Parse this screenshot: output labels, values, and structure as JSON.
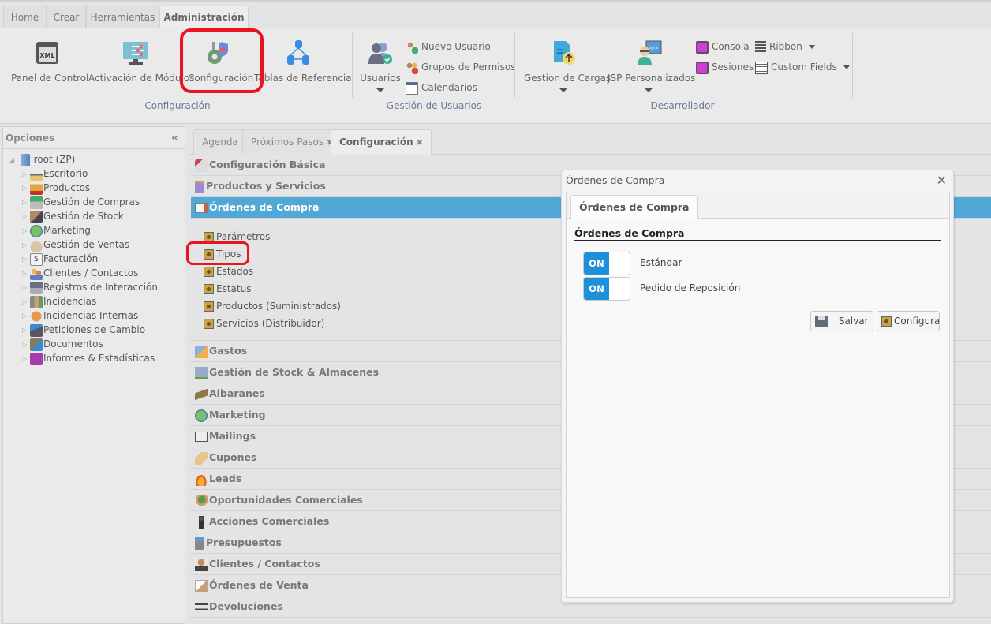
{
  "ribbon": {
    "tabs": [
      {
        "label": "Home",
        "active": false
      },
      {
        "label": "Crear",
        "active": false
      },
      {
        "label": "Herramientas",
        "active": false
      },
      {
        "label": "Administración",
        "active": true
      }
    ],
    "groups": {
      "configuracion": {
        "label": "Configuración",
        "buttons": [
          {
            "label": "Panel de Control",
            "icon": "xml-window-icon"
          },
          {
            "label": "Activación de Módulos",
            "icon": "monitor-sliders-icon"
          },
          {
            "label": "Configuración",
            "icon": "gear-wrench-shield-icon",
            "highlighted": true
          },
          {
            "label": "Tablas de Referencia",
            "icon": "database-tree-icon"
          }
        ]
      },
      "usuarios": {
        "label": "Gestión de Usuarios",
        "main_button": {
          "label": "Usuarios",
          "icon": "users-check-icon",
          "has_dropdown": true
        },
        "small_buttons": [
          {
            "label": "Nuevo Usuario",
            "icon": "user-add-icon"
          },
          {
            "label": "Grupos de Permisos",
            "icon": "user-group-icon"
          },
          {
            "label": "Calendarios",
            "icon": "calendar-icon"
          }
        ]
      },
      "desarrollador": {
        "label": "Desarrollador",
        "buttons": [
          {
            "label": "Gestion de Cargas",
            "icon": "file-upload-icon",
            "has_dropdown": true
          },
          {
            "label": "JSP Personalizados",
            "icon": "developer-code-icon",
            "has_dropdown": true
          }
        ],
        "small_buttons": [
          {
            "label": "Consola",
            "icon": "computer-icon"
          },
          {
            "label": "Sesiones",
            "icon": "computer-icon"
          },
          {
            "label": "Ribbon",
            "icon": "ribbon-list-icon",
            "has_dropdown": true
          },
          {
            "label": "Custom Fields",
            "icon": "form-fields-icon",
            "has_dropdown": true
          }
        ]
      }
    }
  },
  "sidebar": {
    "title": "Opciones",
    "collapse_icon": "«",
    "root": {
      "label": "root (ZP)",
      "icon": "server-icon"
    },
    "items": [
      {
        "label": "Escritorio",
        "icon": "desk-icon"
      },
      {
        "label": "Productos",
        "icon": "boxes-icon"
      },
      {
        "label": "Gestión de Compras",
        "icon": "cart-icon"
      },
      {
        "label": "Gestión de Stock",
        "icon": "stock-icon"
      },
      {
        "label": "Marketing",
        "icon": "globe-wand-icon"
      },
      {
        "label": "Gestión de Ventas",
        "icon": "money-bag-icon"
      },
      {
        "label": "Facturación",
        "icon": "invoice-dollar-icon"
      },
      {
        "label": "Clientes / Contactos",
        "icon": "contacts-icon"
      },
      {
        "label": "Registros de Interacción",
        "icon": "interaction-icon"
      },
      {
        "label": "Incidencias",
        "icon": "incident-icon"
      },
      {
        "label": "Incidencias Internas",
        "icon": "bug-icon"
      },
      {
        "label": "Peticiones de Cambio",
        "icon": "change-request-icon"
      },
      {
        "label": "Documentos",
        "icon": "documents-icon"
      },
      {
        "label": "Informes & Estadísticas",
        "icon": "chart-icon"
      }
    ]
  },
  "content_tabs": [
    {
      "label": "Agenda",
      "closable": false,
      "active": false
    },
    {
      "label": "Próximos Pasos",
      "closable": true,
      "active": false
    },
    {
      "label": "Configuración",
      "closable": true,
      "active": true
    }
  ],
  "close_glyph": "✖",
  "accordion": {
    "sections_before": [
      {
        "label": "Configuración Básica",
        "icon": "checklist-icon"
      },
      {
        "label": "Productos y Servicios",
        "icon": "product-box-icon"
      }
    ],
    "active_section": {
      "label": "Órdenes de Compra",
      "icon": "purchase-order-icon",
      "items": [
        {
          "label": "Parámetros"
        },
        {
          "label": "Tipos",
          "highlighted": true
        },
        {
          "label": "Estados"
        },
        {
          "label": "Estatus"
        },
        {
          "label": "Productos (Suministrados)"
        },
        {
          "label": "Servicios (Distribuidor)"
        }
      ]
    },
    "sections_after": [
      {
        "label": "Gastos",
        "icon": "expenses-icon"
      },
      {
        "label": "Gestión de Stock & Almacenes",
        "icon": "warehouse-icon"
      },
      {
        "label": "Albaranes",
        "icon": "delivery-note-icon"
      },
      {
        "label": "Marketing",
        "icon": "globe-wand-icon"
      },
      {
        "label": "Mailings",
        "icon": "mail-icon"
      },
      {
        "label": "Cupones",
        "icon": "coupon-icon"
      },
      {
        "label": "Leads",
        "icon": "flame-icon"
      },
      {
        "label": "Oportunidades Comerciales",
        "icon": "opportunity-icon"
      },
      {
        "label": "Acciones Comerciales",
        "icon": "person-icon"
      },
      {
        "label": "Presupuestos",
        "icon": "calculator-icon"
      },
      {
        "label": "Clientes / Contactos",
        "icon": "contact-person-icon"
      },
      {
        "label": "Órdenes de Venta",
        "icon": "sales-order-icon"
      },
      {
        "label": "Devoluciones",
        "icon": "return-cart-icon"
      }
    ]
  },
  "dialog": {
    "title": "Órdenes de Compra",
    "close_glyph": "✕",
    "tab_label": "Órdenes de Compra",
    "fieldset_title": "Órdenes de Compra",
    "toggles": [
      {
        "label": "Estándar",
        "state": "ON"
      },
      {
        "label": "Pedido de Reposición",
        "state": "ON"
      }
    ],
    "buttons": {
      "save": "Salvar",
      "configure": "Configurar"
    }
  },
  "colors": {
    "accent_blue": "#51a7d6",
    "toggle_on": "#1e90d9",
    "highlight_red": "#e8141f"
  }
}
